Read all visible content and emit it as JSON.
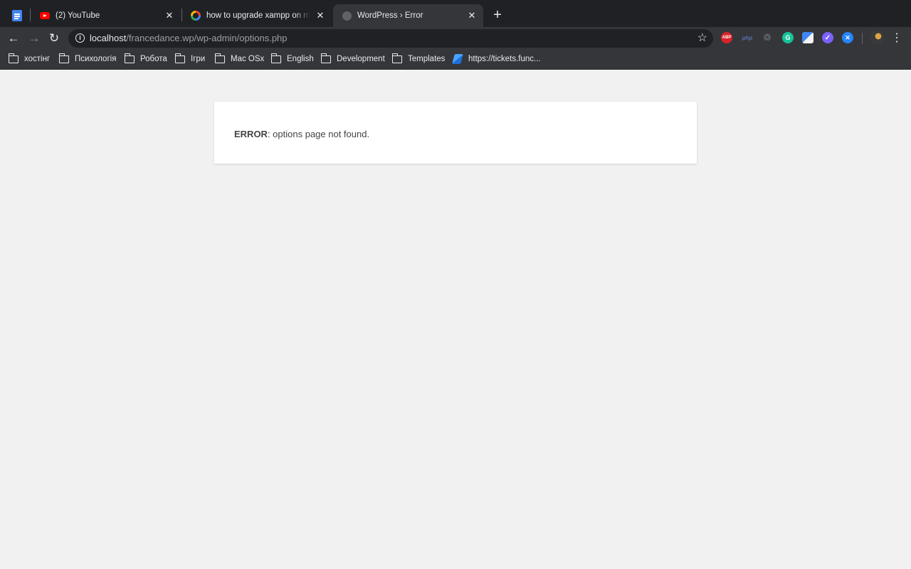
{
  "tabs": [
    {
      "title": "(2) YouTube",
      "favicon": "youtube-icon",
      "active": false
    },
    {
      "title": "how to upgrade xampp on mac o",
      "favicon": "google-icon",
      "active": false
    },
    {
      "title": "WordPress › Error",
      "favicon": "globe-icon",
      "active": true
    }
  ],
  "toolbar": {
    "url_host": "localhost",
    "url_path": "/francedance.wp/wp-admin/options.php",
    "extensions": [
      {
        "name": "adblock-plus-icon",
        "label": "ABP",
        "color": "#d8232a"
      },
      {
        "name": "php-icon",
        "label": "php",
        "color": "#5b6fa8"
      },
      {
        "name": "recycle-icon",
        "label": "",
        "color": "#6b6f75"
      },
      {
        "name": "grammarly-icon",
        "label": "G",
        "color": "#15c39a"
      },
      {
        "name": "google-translate-icon",
        "label": "",
        "color": "#4285f4"
      },
      {
        "name": "checkmark-extension-icon",
        "label": "",
        "color": "#7b61ff"
      },
      {
        "name": "jira-icon",
        "label": "",
        "color": "#2684ff"
      }
    ]
  },
  "bookmarks": [
    {
      "label": "хостінг",
      "type": "folder"
    },
    {
      "label": "Психологія",
      "type": "folder"
    },
    {
      "label": "Робота",
      "type": "folder"
    },
    {
      "label": "Ігри",
      "type": "folder"
    },
    {
      "label": "Mac OSx",
      "type": "folder"
    },
    {
      "label": "English",
      "type": "folder"
    },
    {
      "label": "Development",
      "type": "folder"
    },
    {
      "label": "Templates",
      "type": "folder"
    },
    {
      "label": "https://tickets.func...",
      "type": "link"
    }
  ],
  "page": {
    "error_label": "ERROR",
    "error_text": ": options page not found."
  }
}
